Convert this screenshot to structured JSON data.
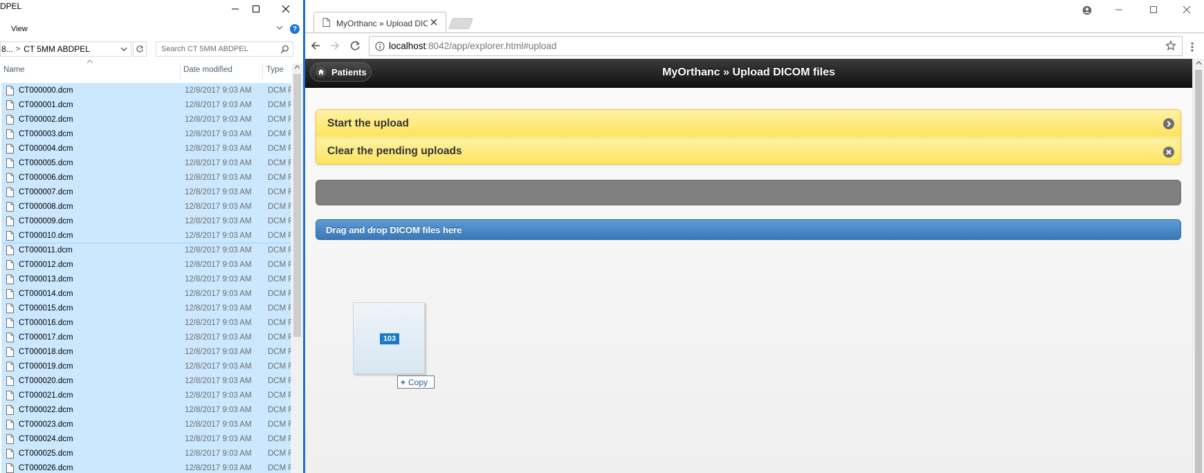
{
  "explorer": {
    "title_fragment": "DPEL",
    "ribbon_view": "View",
    "help": "?",
    "address_prev": "8...",
    "address_current": "CT 5MM ABDPEL",
    "search_placeholder": "Search CT 5MM ABDPEL",
    "columns": {
      "name": "Name",
      "date": "Date modified",
      "type": "Type"
    },
    "files": [
      {
        "name": "CT000000.dcm",
        "date": "12/8/2017 9:03 AM",
        "type": "DCM F"
      },
      {
        "name": "CT000001.dcm",
        "date": "12/8/2017 9:03 AM",
        "type": "DCM F"
      },
      {
        "name": "CT000002.dcm",
        "date": "12/8/2017 9:03 AM",
        "type": "DCM F"
      },
      {
        "name": "CT000003.dcm",
        "date": "12/8/2017 9:03 AM",
        "type": "DCM F"
      },
      {
        "name": "CT000004.dcm",
        "date": "12/8/2017 9:03 AM",
        "type": "DCM F"
      },
      {
        "name": "CT000005.dcm",
        "date": "12/8/2017 9:03 AM",
        "type": "DCM F"
      },
      {
        "name": "CT000006.dcm",
        "date": "12/8/2017 9:03 AM",
        "type": "DCM F"
      },
      {
        "name": "CT000007.dcm",
        "date": "12/8/2017 9:03 AM",
        "type": "DCM F"
      },
      {
        "name": "CT000008.dcm",
        "date": "12/8/2017 9:03 AM",
        "type": "DCM F"
      },
      {
        "name": "CT000009.dcm",
        "date": "12/8/2017 9:03 AM",
        "type": "DCM F"
      },
      {
        "name": "CT000010.dcm",
        "date": "12/8/2017 9:03 AM",
        "type": "DCM F"
      },
      {
        "name": "CT000011.dcm",
        "date": "12/8/2017 9:03 AM",
        "type": "DCM F"
      },
      {
        "name": "CT000012.dcm",
        "date": "12/8/2017 9:03 AM",
        "type": "DCM F"
      },
      {
        "name": "CT000013.dcm",
        "date": "12/8/2017 9:03 AM",
        "type": "DCM F"
      },
      {
        "name": "CT000014.dcm",
        "date": "12/8/2017 9:03 AM",
        "type": "DCM F"
      },
      {
        "name": "CT000015.dcm",
        "date": "12/8/2017 9:03 AM",
        "type": "DCM F"
      },
      {
        "name": "CT000016.dcm",
        "date": "12/8/2017 9:03 AM",
        "type": "DCM F"
      },
      {
        "name": "CT000017.dcm",
        "date": "12/8/2017 9:03 AM",
        "type": "DCM F"
      },
      {
        "name": "CT000018.dcm",
        "date": "12/8/2017 9:03 AM",
        "type": "DCM F"
      },
      {
        "name": "CT000019.dcm",
        "date": "12/8/2017 9:03 AM",
        "type": "DCM F"
      },
      {
        "name": "CT000020.dcm",
        "date": "12/8/2017 9:03 AM",
        "type": "DCM F"
      },
      {
        "name": "CT000021.dcm",
        "date": "12/8/2017 9:03 AM",
        "type": "DCM F"
      },
      {
        "name": "CT000022.dcm",
        "date": "12/8/2017 9:03 AM",
        "type": "DCM F"
      },
      {
        "name": "CT000023.dcm",
        "date": "12/8/2017 9:03 AM",
        "type": "DCM F"
      },
      {
        "name": "CT000024.dcm",
        "date": "12/8/2017 9:03 AM",
        "type": "DCM F"
      },
      {
        "name": "CT000025.dcm",
        "date": "12/8/2017 9:03 AM",
        "type": "DCM F"
      },
      {
        "name": "CT000026.dcm",
        "date": "12/8/2017 9:03 AM",
        "type": "DCM F"
      }
    ]
  },
  "browser": {
    "tab_title": "MyOrthanc » Upload DIC",
    "url_host": "localhost",
    "url_path": ":8042/app/explorer.html#upload",
    "patients_button": "Patients",
    "page_title": "MyOrthanc » Upload DICOM files",
    "start_upload": "Start the upload",
    "clear_pending": "Clear the pending uploads",
    "dropzone": "Drag and drop DICOM files here",
    "drag_count": "103",
    "copy_tooltip": "Copy"
  },
  "colors": {
    "selection": "#cce8ff",
    "accent_blue": "#1a6fd1",
    "header_dark": "#1a1a1a",
    "yellow_button": "#fde45a",
    "progress_gray": "#808080",
    "dropzone_blue": "#4a8ac7"
  },
  "icons": [
    "minimize-icon",
    "maximize-icon",
    "close-icon",
    "chevron-down-icon",
    "help-icon",
    "refresh-icon",
    "search-icon",
    "file-icon",
    "sort-caret-icon",
    "page-icon",
    "tab-close-icon",
    "profile-icon",
    "back-arrow-icon",
    "forward-arrow-icon",
    "reload-icon",
    "info-icon",
    "star-icon",
    "kebab-menu-icon",
    "home-icon",
    "arrow-right-circle-icon",
    "close-circle-icon",
    "plus-icon"
  ]
}
